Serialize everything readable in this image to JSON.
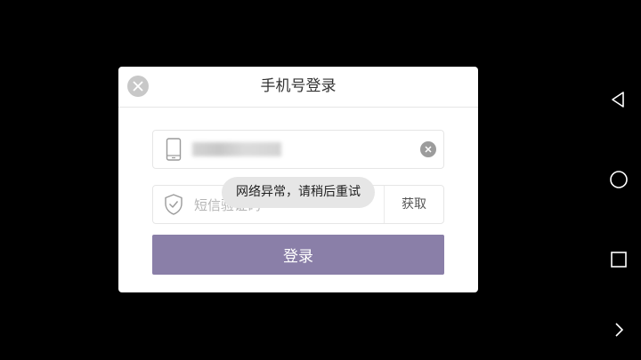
{
  "dialog": {
    "title": "手机号登录",
    "phone_value": "",
    "code_placeholder": "短信验证码",
    "get_code_label": "获取",
    "login_label": "登录"
  },
  "toast": {
    "message": "网络异常，请稍后重试"
  },
  "nav_bar": {
    "icons": [
      "back-icon",
      "home-icon",
      "recents-icon",
      "expand-icon"
    ]
  },
  "colors": {
    "accent": "#8a7fa8",
    "background": "#000000"
  }
}
